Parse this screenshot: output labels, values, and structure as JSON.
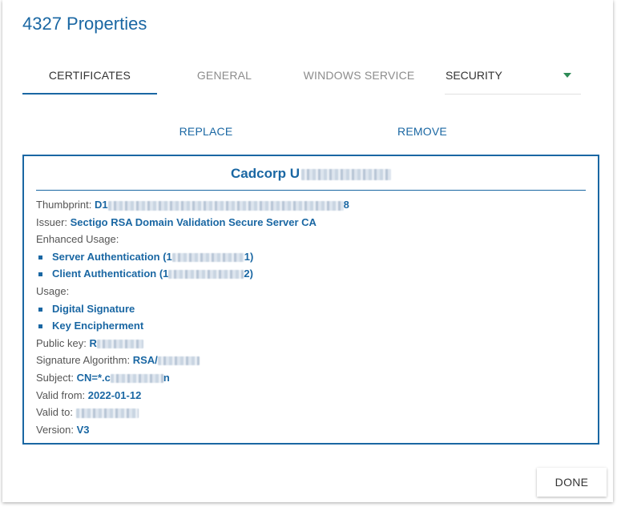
{
  "dialog": {
    "title": "4327 Properties"
  },
  "tabs": {
    "certificates": "CERTIFICATES",
    "general": "GENERAL",
    "windows_service": "WINDOWS SERVICE",
    "security_dropdown": "SECURITY"
  },
  "actions": {
    "replace": "REPLACE",
    "remove": "REMOVE"
  },
  "certificate": {
    "title": "Cadcorp U",
    "thumbprint_label": "Thumbprint:",
    "thumbprint_start": "D1",
    "thumbprint_end": "8",
    "issuer_label": "Issuer:",
    "issuer": "Sectigo RSA Domain Validation Secure Server CA",
    "enhanced_usage_label": "Enhanced Usage:",
    "enhanced_usage": [
      {
        "name_start": "Server Authentication (1",
        "name_end": "1)"
      },
      {
        "name_start": "Client Authentication (1",
        "name_end": "2)"
      }
    ],
    "usage_label": "Usage:",
    "usage": [
      "Digital Signature",
      "Key Encipherment"
    ],
    "public_key_label": "Public key:",
    "public_key_start": "R",
    "signature_algorithm_label": "Signature Algorithm:",
    "signature_algorithm_start": "RSA/",
    "subject_label": "Subject:",
    "subject_start": "CN=*.c",
    "subject_end": "n",
    "valid_from_label": "Valid from:",
    "valid_from": "2022-01-12",
    "valid_to_label": "Valid to:",
    "version_label": "Version:",
    "version": "V3"
  },
  "footer": {
    "done": "DONE"
  },
  "colors": {
    "accent": "#1a67a3",
    "dropdown_caret": "#2e8b57"
  }
}
